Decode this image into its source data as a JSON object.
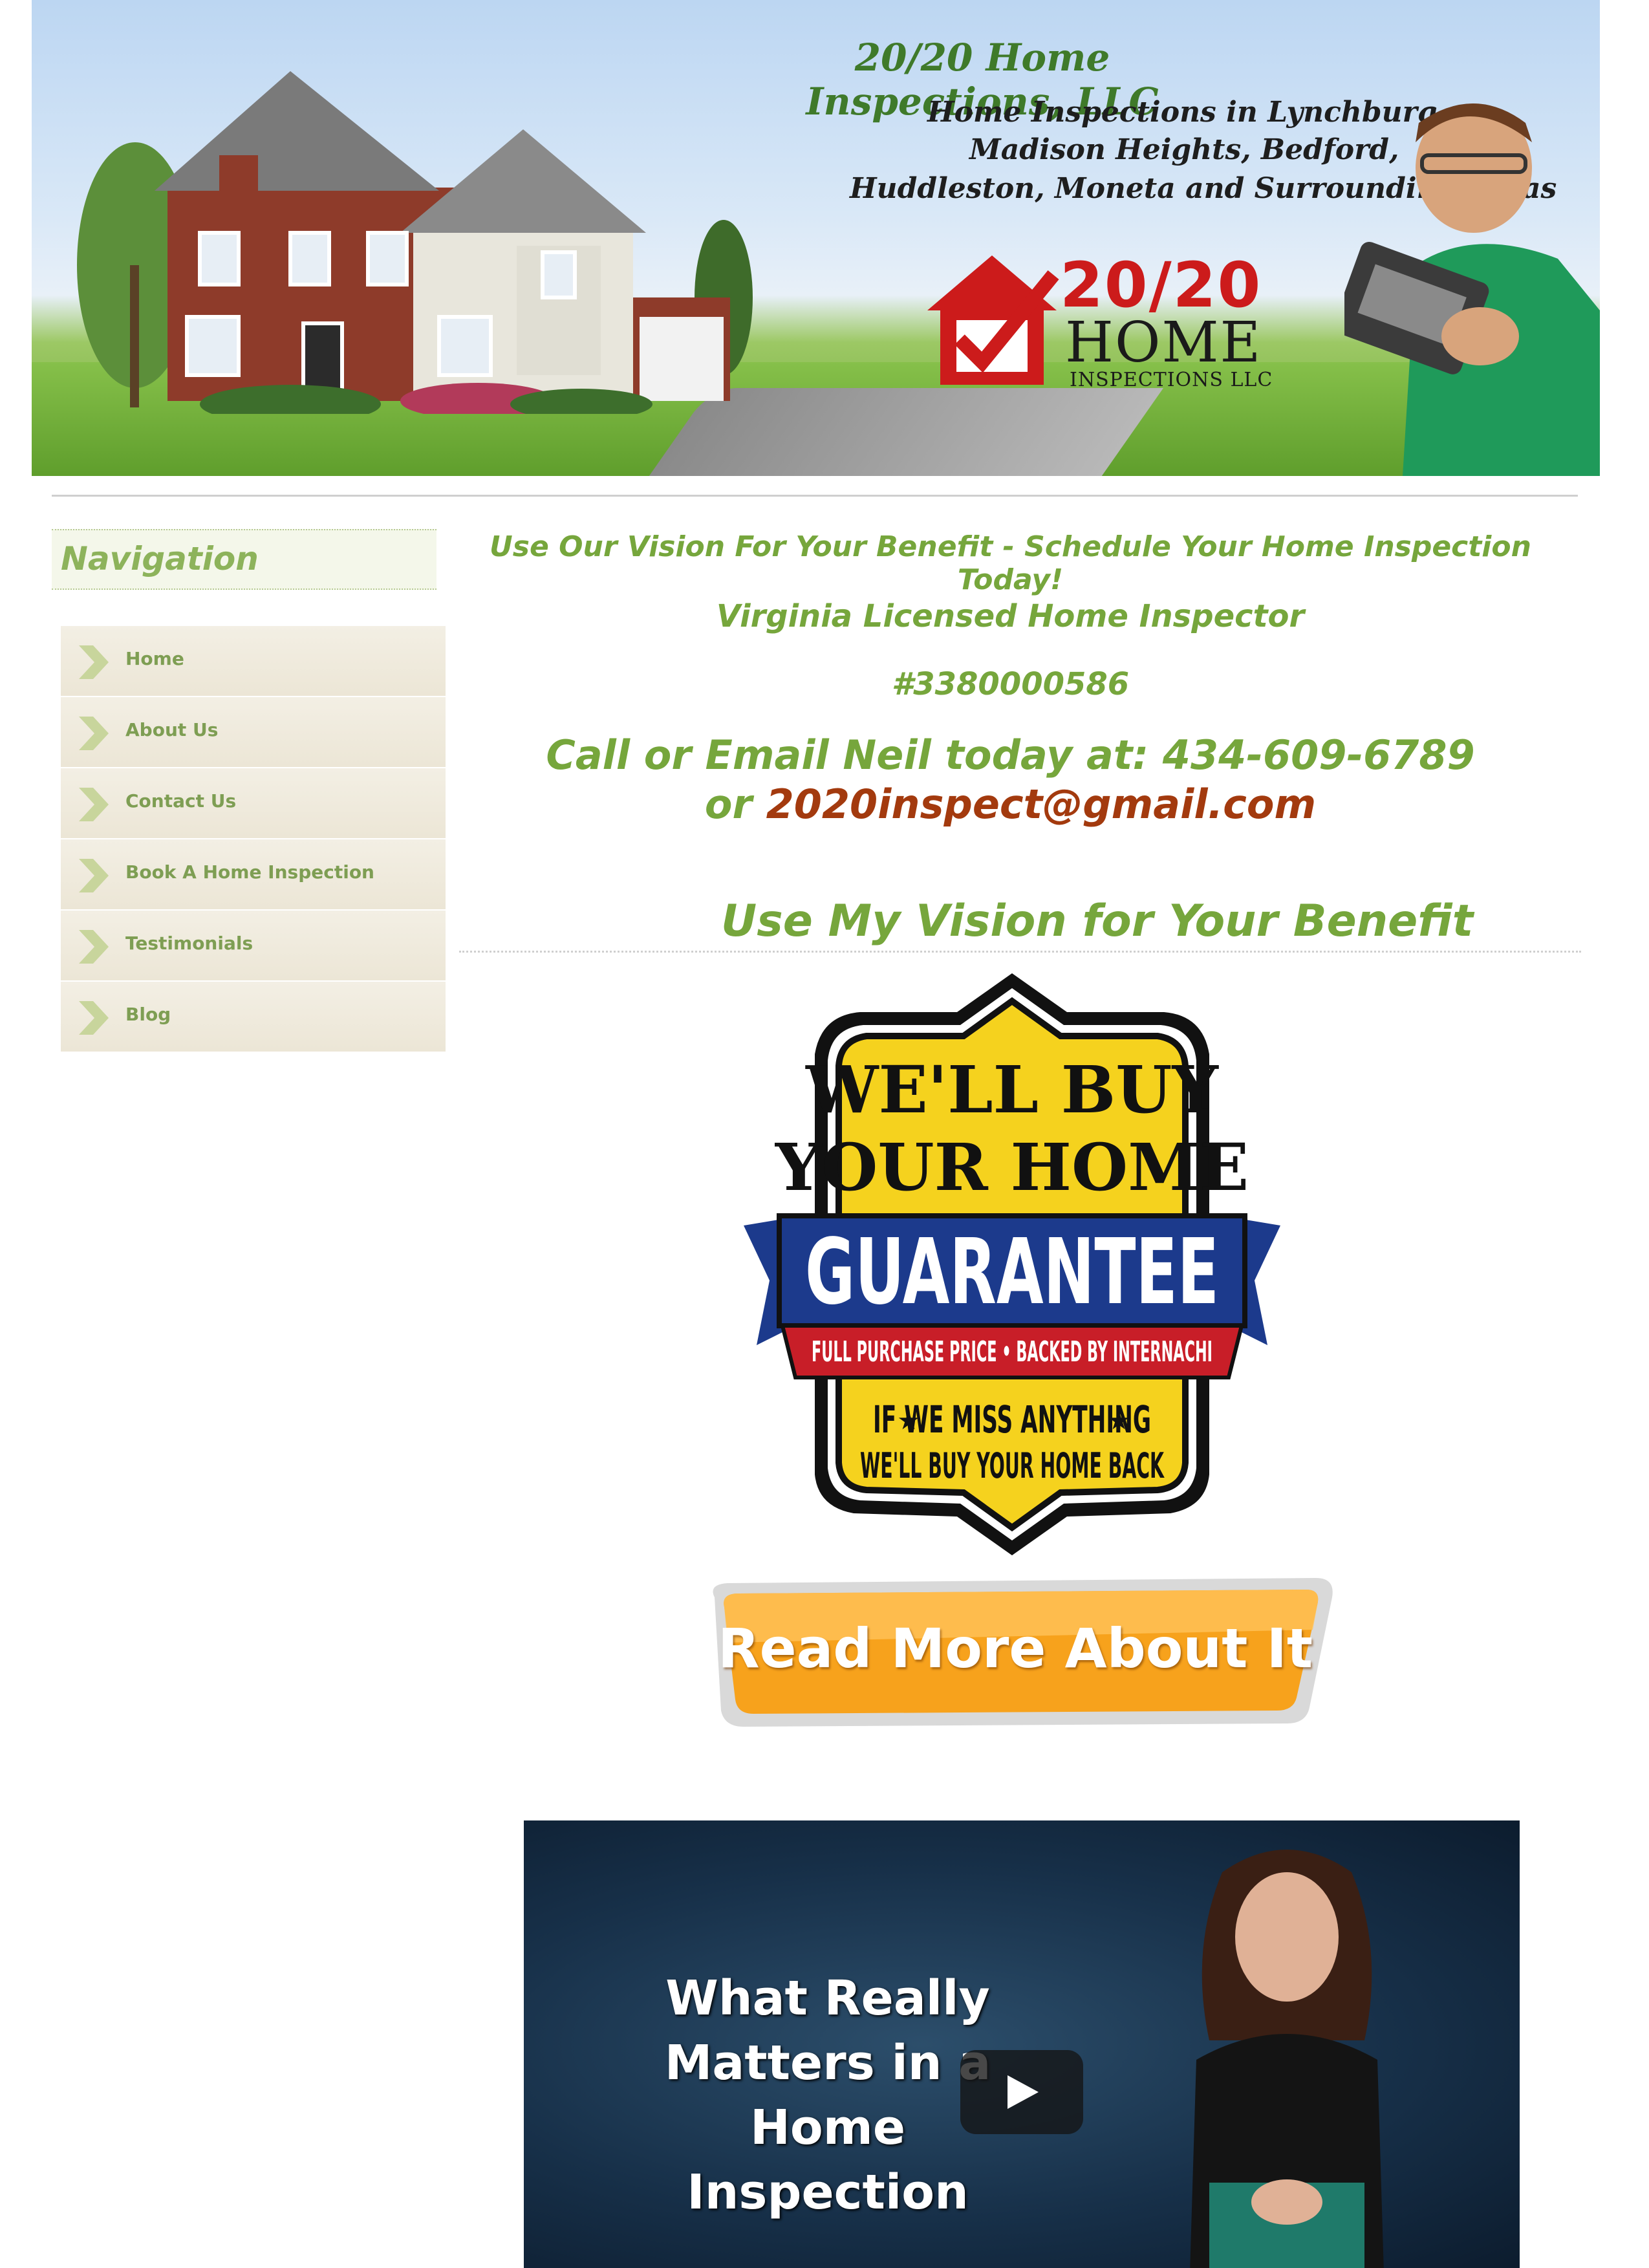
{
  "header": {
    "title": "20/20 Home Inspections, LLC",
    "areas_line1": "Home Inspections in Lynchburg,",
    "areas_line2": "Madison Heights, Bedford,",
    "areas_line3": "Huddleston, Moneta and Surrounding Areas",
    "logo_top": "20/20",
    "logo_mid": "HOME",
    "logo_bot": "INSPECTIONS LLC",
    "logo_color": "#cc1b1b"
  },
  "sidebar": {
    "title": "Navigation",
    "items": [
      {
        "label": "Home"
      },
      {
        "label": "About Us"
      },
      {
        "label": "Contact Us"
      },
      {
        "label": "Book A Home Inspection"
      },
      {
        "label": "Testimonials"
      },
      {
        "label": "Blog"
      }
    ]
  },
  "main": {
    "tagline": "Use Our Vision For Your Benefit - Schedule Your Home Inspection Today!",
    "licensed": "Virginia Licensed Home Inspector",
    "license_number": "#3380000586",
    "call_prefix": "Call or Email Neil today at:  434-609-6789",
    "or_text": "or ",
    "email": "2020inspect@gmail.com",
    "vision_heading": "Use My Vision for Your Benefit",
    "accent_color": "#76a63c"
  },
  "badge": {
    "line1": "WE'LL BUY",
    "line2": "YOUR HOME",
    "line3": "GUARANTEE",
    "line4": "FULL PURCHASE PRICE  •  BACKED BY INTERNACHI",
    "line5": "IF WE MISS ANYTHING",
    "line6": "WE'LL BUY YOUR HOME BACK"
  },
  "read_more": {
    "label": "Read More About It"
  },
  "video": {
    "title_line1": "What Really",
    "title_line2": "Matters in a",
    "title_line3": "Home Inspection",
    "play_icon": "play-icon"
  }
}
